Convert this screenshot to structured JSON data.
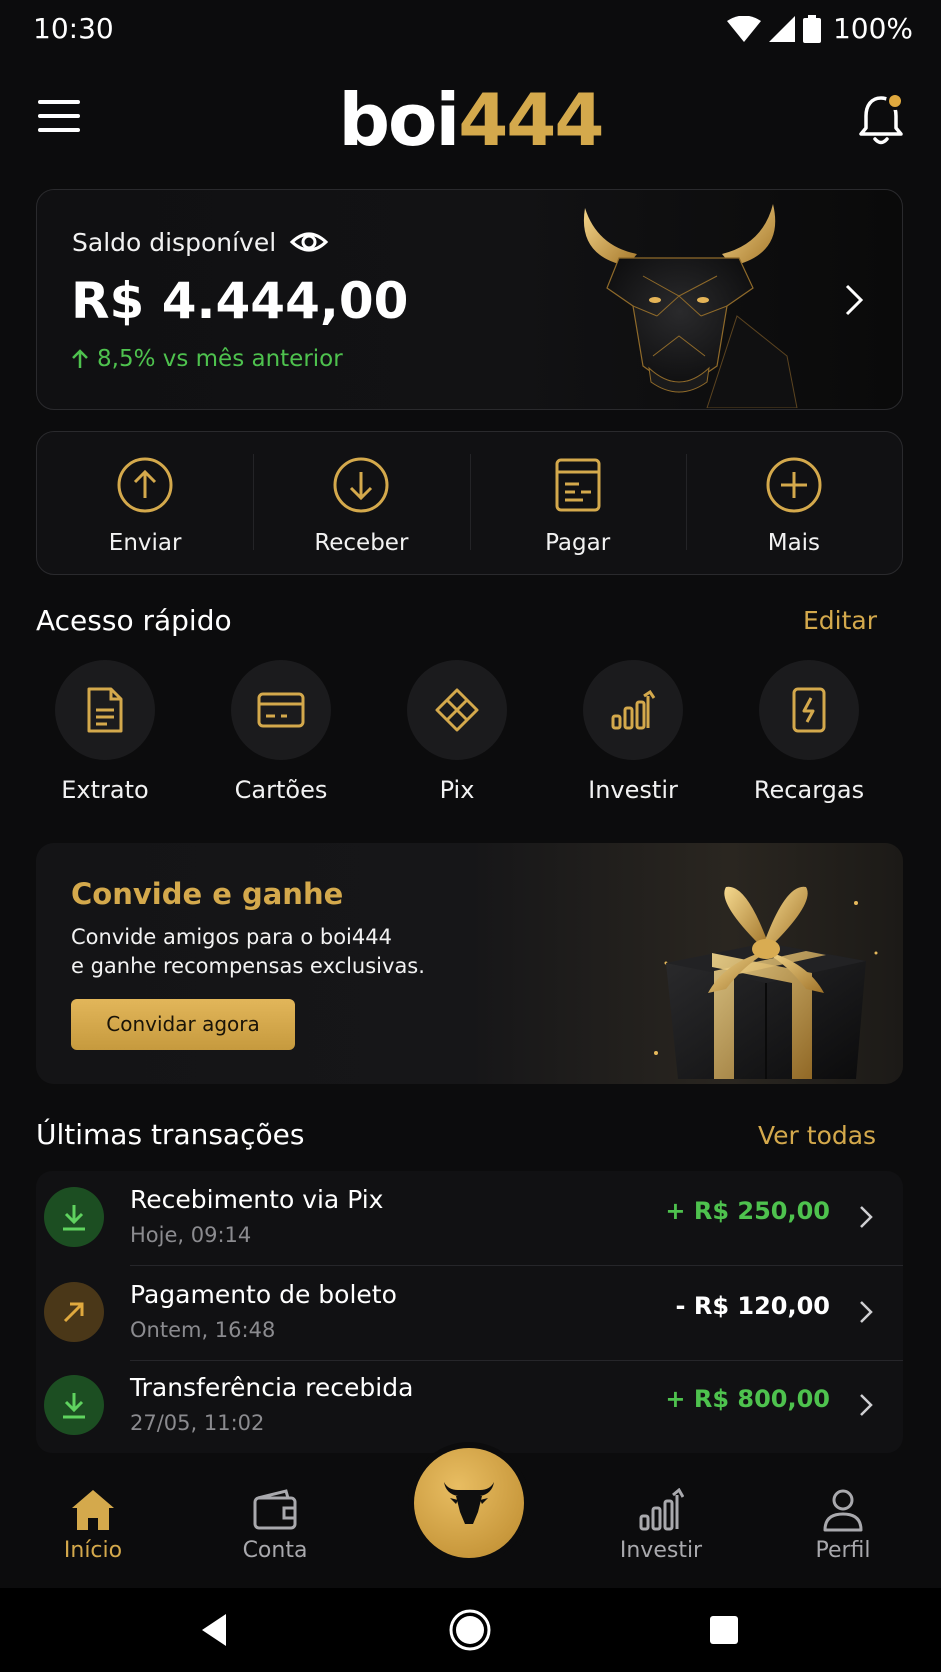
{
  "status_bar": {
    "time": "10:30",
    "battery": "100%"
  },
  "header": {
    "logo_white": "boi",
    "logo_gold": "444"
  },
  "balance": {
    "label": "Saldo disponível",
    "value": "R$ 4.444,00",
    "change": "8,5% vs mês anterior"
  },
  "actions": [
    {
      "label": "Enviar",
      "icon": "arrow-up-circle-icon"
    },
    {
      "label": "Receber",
      "icon": "arrow-down-circle-icon"
    },
    {
      "label": "Pagar",
      "icon": "bill-icon"
    },
    {
      "label": "Mais",
      "icon": "plus-circle-icon"
    }
  ],
  "quick_access": {
    "title": "Acesso rápido",
    "edit": "Editar",
    "items": [
      {
        "label": "Extrato",
        "icon": "document-icon"
      },
      {
        "label": "Cartões",
        "icon": "card-icon"
      },
      {
        "label": "Pix",
        "icon": "pix-icon"
      },
      {
        "label": "Investir",
        "icon": "chart-icon"
      },
      {
        "label": "Recargas",
        "icon": "phone-charge-icon"
      }
    ]
  },
  "invite": {
    "title": "Convide e ganhe",
    "line1": "Convide amigos para o boi444",
    "line2": "e ganhe recompensas exclusivas.",
    "button": "Convidar agora"
  },
  "transactions": {
    "title": "Últimas transações",
    "see_all": "Ver todas",
    "items": [
      {
        "title": "Recebimento via Pix",
        "date": "Hoje, 09:14",
        "amount": "+ R$ 250,00",
        "kind": "in"
      },
      {
        "title": "Pagamento de boleto",
        "date": "Ontem, 16:48",
        "amount": "- R$ 120,00",
        "kind": "out"
      },
      {
        "title": "Transferência recebida",
        "date": "27/05, 11:02",
        "amount": "+ R$ 800,00",
        "kind": "in"
      }
    ]
  },
  "bottom_nav": [
    {
      "label": "Início",
      "active": true
    },
    {
      "label": "Conta",
      "active": false
    },
    {
      "label": "Investir",
      "active": false
    },
    {
      "label": "Perfil",
      "active": false
    }
  ],
  "colors": {
    "gold": "#d4a94c",
    "green": "#4ec24e",
    "background": "#0c0c0d"
  }
}
